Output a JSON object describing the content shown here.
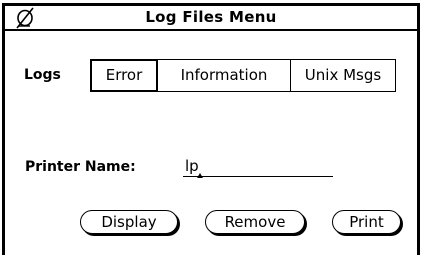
{
  "window": {
    "title": "Log Files Menu",
    "title_icon": "window-menu-icon"
  },
  "logs": {
    "label": "Logs",
    "options": [
      "Error",
      "Information",
      "Unix Msgs"
    ],
    "selected": "Error"
  },
  "printer": {
    "label": "Printer Name:",
    "value": "lp"
  },
  "buttons": {
    "display": "Display",
    "remove": "Remove",
    "print": "Print"
  }
}
